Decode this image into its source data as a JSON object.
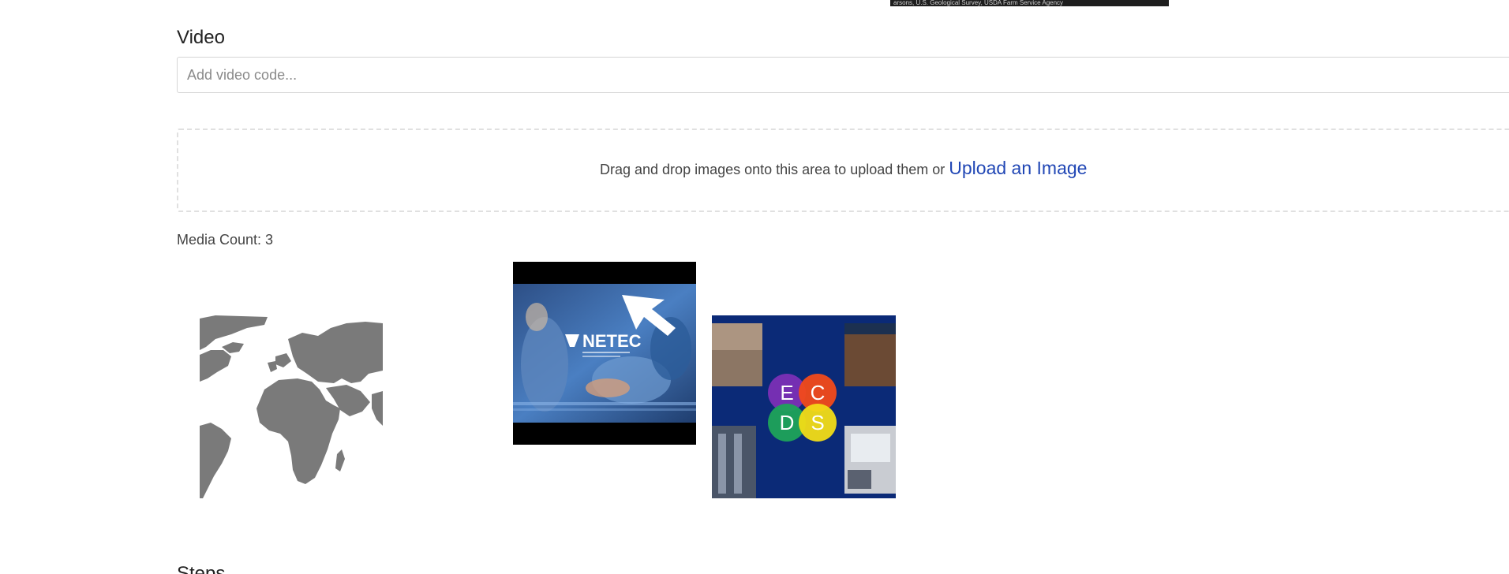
{
  "map_attribution": "arsons, U.S. Geological Survey, USDA Farm Service Agency",
  "video": {
    "label": "Video",
    "placeholder": "Add video code...",
    "value": ""
  },
  "dropzone": {
    "text": "Drag and drop images onto this area to upload them or",
    "upload_link": "Upload an Image"
  },
  "media": {
    "count_label": "Media Count: 3",
    "items": [
      {
        "kind": "world-map-image"
      },
      {
        "kind": "netec-video-thumbnail",
        "logo_text": "NETEC"
      },
      {
        "kind": "ecds-logo-image",
        "letters": [
          "E",
          "C",
          "D",
          "S"
        ]
      }
    ]
  },
  "steps": {
    "label": "Steps"
  },
  "colors": {
    "link": "#2147b5",
    "map_land": "#7a7a7a",
    "ecds_bg": "#0b2a77",
    "netec_overlay": "#3c6fb5"
  }
}
